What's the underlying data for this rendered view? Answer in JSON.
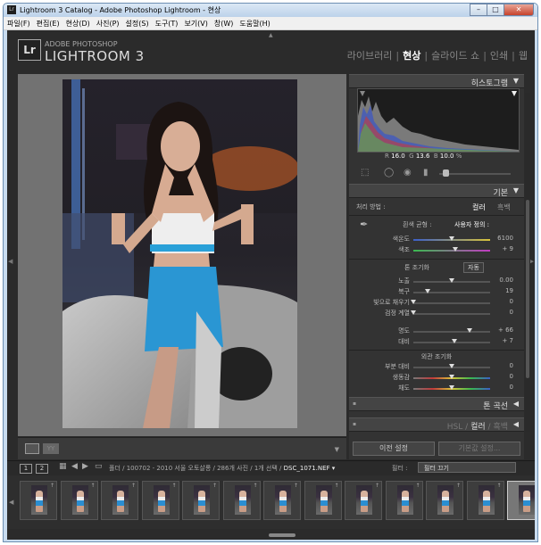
{
  "window": {
    "title": "Lightroom 3 Catalog - Adobe Photoshop Lightroom - 현상",
    "icon_label": "Lr",
    "min": "–",
    "max": "□",
    "close": "✕"
  },
  "menu": [
    "파일(F)",
    "편집(E)",
    "현상(D)",
    "사진(P)",
    "설정(S)",
    "도구(T)",
    "보기(V)",
    "창(W)",
    "도움말(H)"
  ],
  "brand": {
    "logo": "Lr",
    "adobe": "ADOBE PHOTOSHOP",
    "product": "LIGHTROOM 3"
  },
  "modules": {
    "library": "라이브러리",
    "develop": "현상",
    "slideshow": "슬라이드 쇼",
    "print": "인쇄",
    "web": "웹",
    "sep": "|"
  },
  "histogram": {
    "title": "히스토그램",
    "r_label": "R",
    "r": "16.0",
    "g_label": "G",
    "g": "13.6",
    "b_label": "B",
    "b": "10.0",
    "pct": "%"
  },
  "basic": {
    "title": "기본",
    "treatment_label": "처리 방법 :",
    "treatment_color": "컬러",
    "treatment_bw": "흑백",
    "wb_label": "흰색 균형 :",
    "wb_value": "사용자 정의 :",
    "temp_label": "색온도",
    "temp_value": "6100",
    "temp_pos": 0.5,
    "tint_label": "색조",
    "tint_value": "+ 9",
    "tint_pos": 0.55,
    "tone_title": "톤 조기화",
    "auto": "자동",
    "exposure_label": "노출",
    "exposure_value": "0.00",
    "exposure_pos": 0.5,
    "recovery_label": "복구",
    "recovery_value": "19",
    "recovery_pos": 0.19,
    "fill_label": "빛으로 채우기",
    "fill_value": "0",
    "fill_pos": 0.0,
    "blacks_label": "검정 계열",
    "blacks_value": "0",
    "blacks_pos": 0.0,
    "brightness_label": "명도",
    "brightness_value": "+ 66",
    "brightness_pos": 0.73,
    "contrast_label": "대비",
    "contrast_value": "+ 7",
    "contrast_pos": 0.53,
    "presence_title": "외관 조기화",
    "clarity_label": "부분 대비",
    "clarity_value": "0",
    "clarity_pos": 0.5,
    "vibrance_label": "생동감",
    "vibrance_value": "0",
    "vibrance_pos": 0.5,
    "saturation_label": "채도",
    "saturation_value": "0",
    "saturation_pos": 0.5
  },
  "panels": {
    "tone_curve": "톤 곡선",
    "hsl": "HSL",
    "hsl_sep": "/",
    "hsl_color": "컬러",
    "hsl_bw": "흑백"
  },
  "buttons": {
    "previous": "이전 설정",
    "reset": "기본값 설정..."
  },
  "filmstrip_bar": {
    "page1": "1",
    "page2": "2",
    "breadcrumb": "폴더 / 100702 - 2010 서울 오토살롱 / 286개 사진 / 1개 선택 /",
    "filename": "DSC_1071.NEF ▾",
    "filter_label": "필터 :",
    "filter_value": "필터 끄기"
  },
  "thumbnails": 13
}
